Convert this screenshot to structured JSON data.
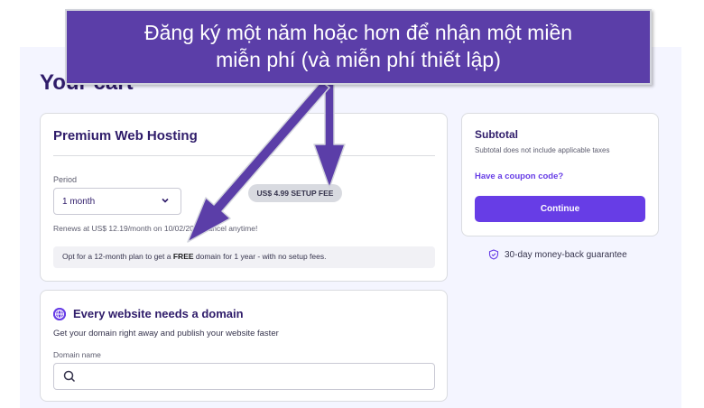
{
  "callout": {
    "line1": "Đăng ký một năm hoặc hơn để nhận một miền",
    "line2": "miễn phí (và miễn phí thiết lập)"
  },
  "cart": {
    "title": "Your cart"
  },
  "hosting": {
    "title": "Premium Web Hosting",
    "period_label": "Period",
    "period_value": "1 month",
    "setup_fee": "US$ 4.99 SETUP FEE",
    "renews_text": "Renews at US$ 12.19/month on 10/02/20... Cancel anytime!",
    "promo_prefix": "Opt for a 12-month plan to get a ",
    "promo_bold": "FREE",
    "promo_suffix": " domain for 1 year - with no setup fees."
  },
  "domain": {
    "heading": "Every website needs a domain",
    "subheading": "Get your domain right away and publish your website faster",
    "field_label": "Domain name",
    "placeholder": ""
  },
  "subtotal": {
    "title": "Subtotal",
    "note": "Subtotal does not include applicable taxes",
    "coupon": "Have a coupon code?",
    "continue": "Continue"
  },
  "guarantee": {
    "text": "30-day money-back guarantee"
  },
  "colors": {
    "brand": "#673de6",
    "callout_bg": "#5b3ea8",
    "text_dark": "#2f1c6a"
  },
  "icons": [
    "globe-icon",
    "search-icon",
    "chevron-down-icon",
    "shield-check-icon"
  ]
}
